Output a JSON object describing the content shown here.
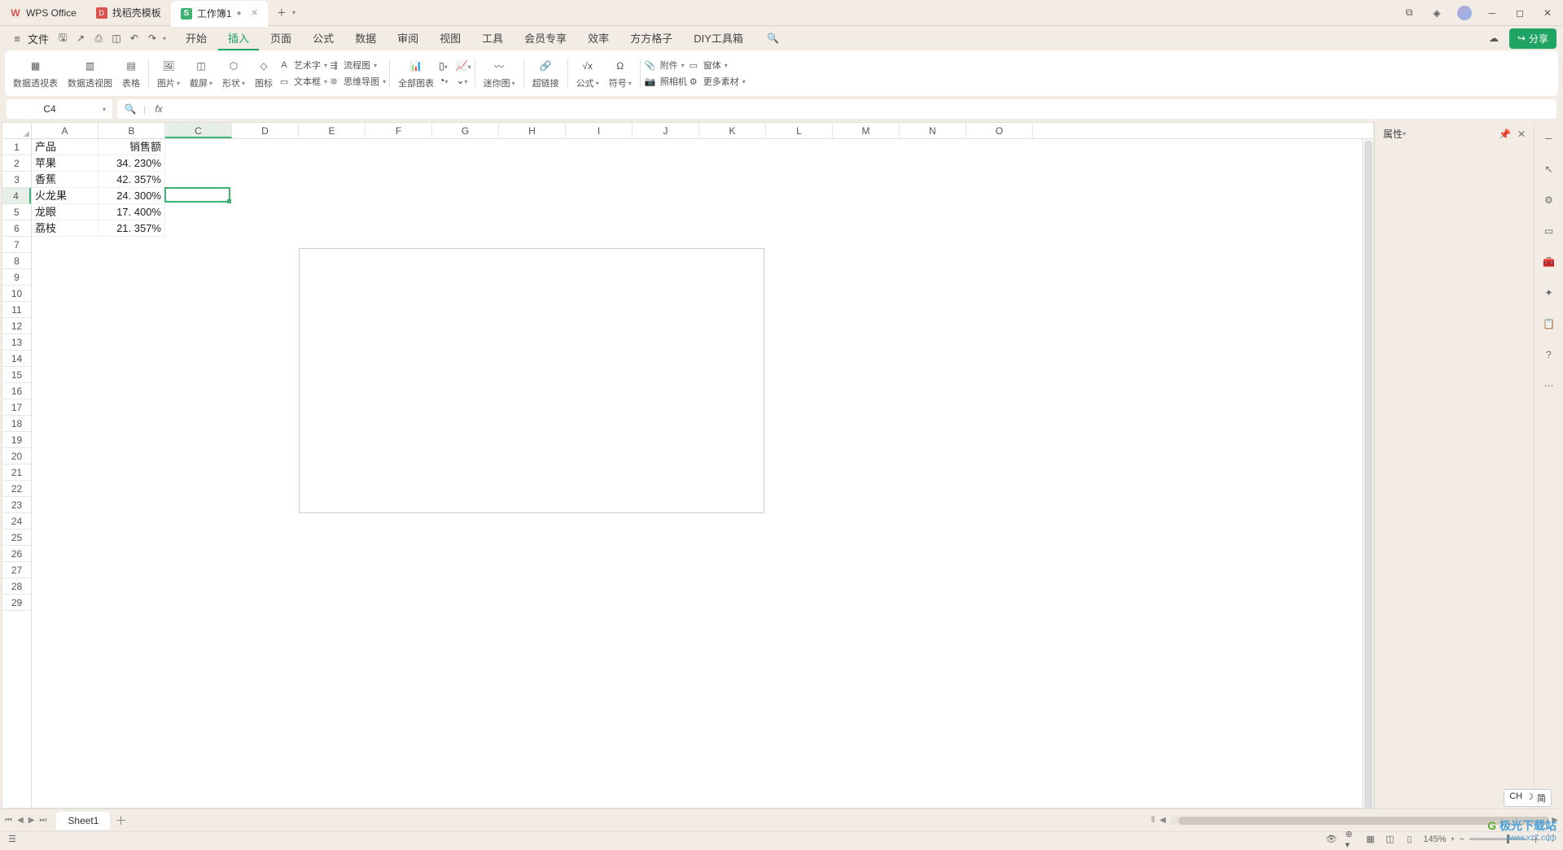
{
  "tabs": {
    "app": "WPS Office",
    "template": "找稻壳模板",
    "doc": "工作簿1"
  },
  "menu": {
    "file": "文件",
    "items": [
      "开始",
      "插入",
      "页面",
      "公式",
      "数据",
      "审阅",
      "视图",
      "工具",
      "会员专享",
      "效率",
      "方方格子",
      "DIY工具箱"
    ],
    "active_index": 1
  },
  "share_label": "分享",
  "ribbon": {
    "g1": {
      "a": "数据透视表",
      "b": "数据透视图",
      "c": "表格"
    },
    "g2_big": {
      "pic": "图片",
      "screen": "截屏",
      "shape": "形状",
      "icon": "图标"
    },
    "g2_small": {
      "art": "艺术字",
      "flow": "流程图",
      "textbox": "文本框",
      "mind": "思维导图"
    },
    "g3": {
      "all": "全部图表"
    },
    "g4": {
      "spark": "迷你图"
    },
    "g5": {
      "link": "超链接"
    },
    "g6": {
      "formula": "公式",
      "symbol": "符号"
    },
    "g7": {
      "attach": "附件",
      "obj": "窗体",
      "cam": "照相机",
      "more": "更多素材"
    }
  },
  "name_box_value": "C4",
  "properties": {
    "title": "属性"
  },
  "columns": [
    "A",
    "B",
    "C",
    "D",
    "E",
    "F",
    "G",
    "H",
    "I",
    "J",
    "K",
    "L",
    "M",
    "N",
    "O"
  ],
  "row_count": 29,
  "selected_cell": {
    "col": 2,
    "row": 3
  },
  "cells": {
    "A1": "产品",
    "B1": "销售额",
    "A2": "苹果",
    "B2": "34. 230%",
    "A3": "香蕉",
    "B3": "42. 357%",
    "A4": "火龙果",
    "B4": "24. 300%",
    "A5": "龙眼",
    "B5": "17. 400%",
    "A6": "荔枝",
    "B6": "21. 357%"
  },
  "sheet": {
    "name": "Sheet1"
  },
  "status": {
    "zoom": "145%"
  },
  "ime": {
    "lang": "CH",
    "mode": "简"
  },
  "watermark": {
    "name": "极光下载站",
    "url": "www.xz7.com"
  }
}
